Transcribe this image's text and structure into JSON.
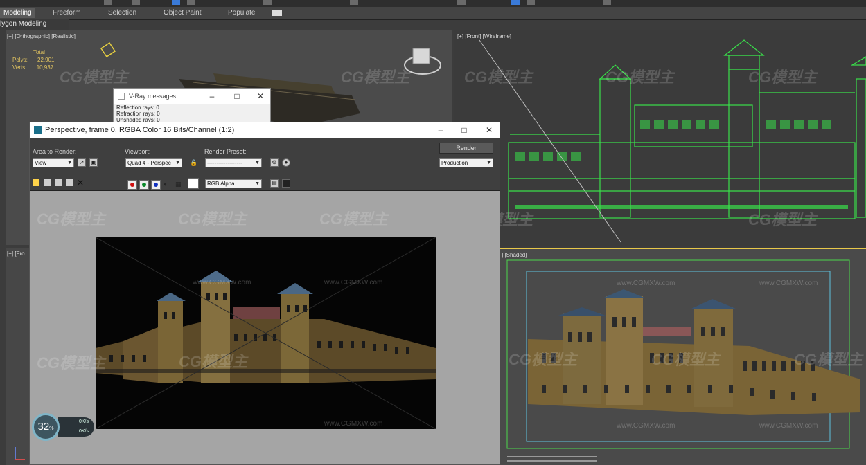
{
  "ribbon": {
    "tabs": [
      "Modeling",
      "Freeform",
      "Selection",
      "Object Paint",
      "Populate"
    ],
    "sub_label": "lygon Modeling"
  },
  "viewports": {
    "perspective_label": "[+] [Orthographic] [Realistic]",
    "front_label": "[+] [Front] [Wireframe]",
    "left_label": "[+] [Fro",
    "shaded_label": "] [Shaded]",
    "stats": {
      "total_label": "Total",
      "polys_label": "Polys:",
      "polys": "22,901",
      "verts_label": "Verts:",
      "verts": "10,937"
    }
  },
  "vray_messages": {
    "title": "V-Ray messages",
    "lines": [
      "Reflection rays: 0",
      "Refraction rays: 0",
      "Unshaded rays: 0"
    ]
  },
  "render_window": {
    "title": "Perspective, frame 0, RGBA Color 16 Bits/Channel (1:2)",
    "area_label": "Area to Render:",
    "area_value": "View",
    "viewport_label": "Viewport:",
    "viewport_value": "Quad 4 - Perspec",
    "preset_label": "Render Preset:",
    "preset_value": "-------------------",
    "render_button": "Render",
    "production_value": "Production",
    "channel_value": "RGB Alpha"
  },
  "progress": {
    "percent": "32",
    "percent_unit": "%",
    "up_rate": "0K/s",
    "down_rate": "0K/s"
  },
  "watermark": {
    "brand": "CG模型主",
    "url": "www.CGMXW.com"
  },
  "colors": {
    "wireframe": "#39e04a",
    "selected_border": "#e8c84a",
    "window_bg": "#a5a5a5"
  }
}
